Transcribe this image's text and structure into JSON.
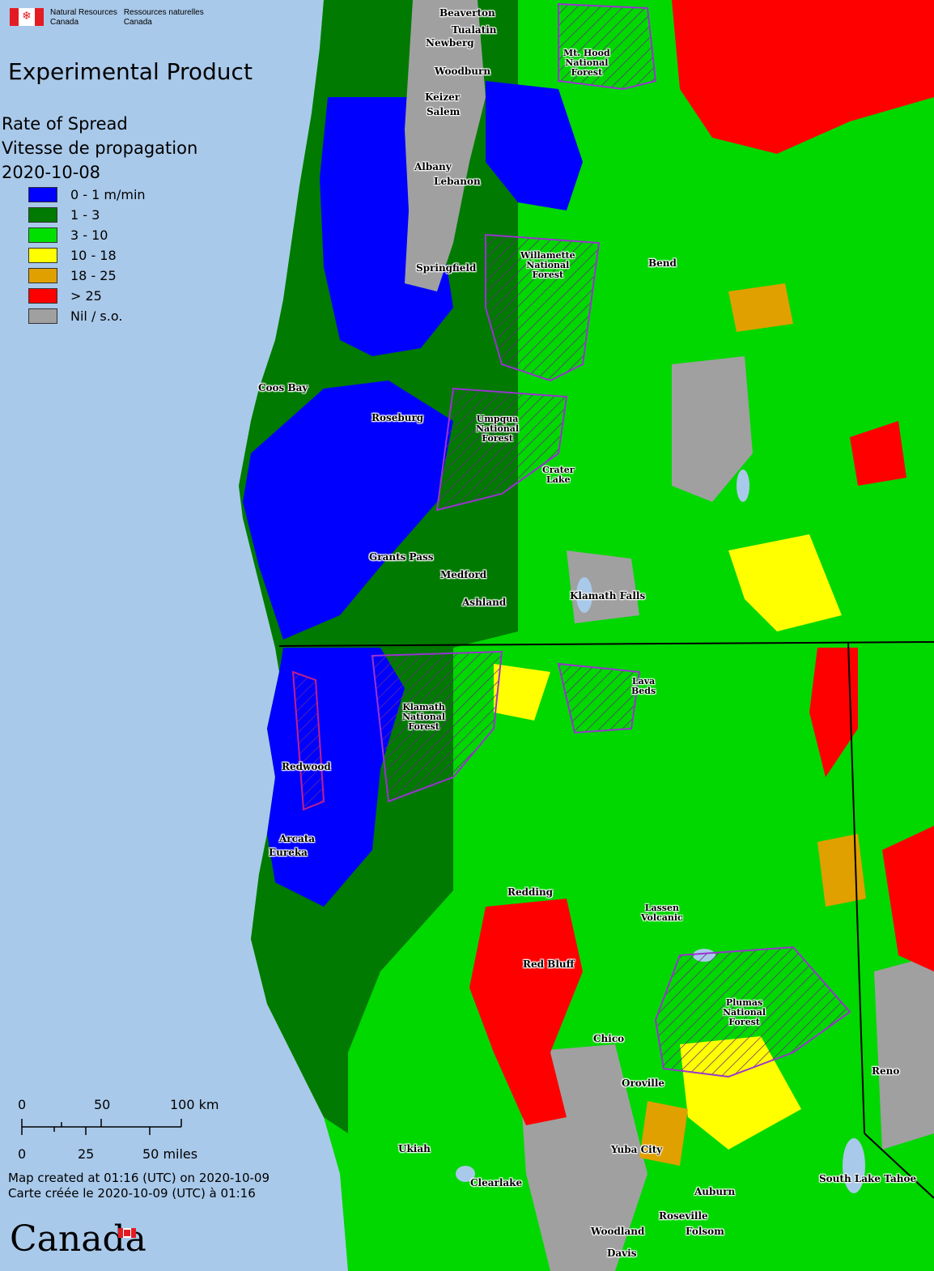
{
  "header": {
    "agency_en": [
      "Natural Resources",
      "Canada"
    ],
    "agency_fr": [
      "Ressources naturelles",
      "Canada"
    ],
    "flag_icon": "canada-flag-icon"
  },
  "product_title": "Experimental Product",
  "legend": {
    "title_en": "Rate of Spread",
    "title_fr": "Vitesse de propagation",
    "date": "2020-10-08",
    "items": [
      {
        "label": "0 - 1 m/min",
        "color": "#0000ff"
      },
      {
        "label": "1 - 3",
        "color": "#007a00"
      },
      {
        "label": "3 - 10",
        "color": "#00e000"
      },
      {
        "label": "10 - 18",
        "color": "#ffff00"
      },
      {
        "label": "18 - 25",
        "color": "#e0a000"
      },
      {
        "label": "> 25",
        "color": "#ff0000"
      },
      {
        "label": "Nil / s.o.",
        "color": "#a0a0a0"
      }
    ]
  },
  "scale": {
    "km_labels": [
      "0",
      "50",
      "100 km"
    ],
    "mile_labels": [
      "0",
      "25",
      "50 miles"
    ]
  },
  "credits": {
    "line_en": "Map created at 01:16 (UTC) on 2020-10-09",
    "line_fr": "Carte créée le 2020-10-09 (UTC) à 01:16"
  },
  "wordmark": "Canada",
  "places": [
    {
      "id": "beaverton",
      "name": "Beaverton"
    },
    {
      "id": "tualatin",
      "name": "Tualatin"
    },
    {
      "id": "newberg",
      "name": "Newberg"
    },
    {
      "id": "woodburn",
      "name": "Woodburn"
    },
    {
      "id": "keizer",
      "name": "Keizer"
    },
    {
      "id": "salem",
      "name": "Salem"
    },
    {
      "id": "albany",
      "name": "Albany"
    },
    {
      "id": "lebanon",
      "name": "Lebanon"
    },
    {
      "id": "springfield",
      "name": "Springfield"
    },
    {
      "id": "bend",
      "name": "Bend"
    },
    {
      "id": "coos-bay",
      "name": "Coos Bay"
    },
    {
      "id": "roseburg",
      "name": "Roseburg"
    },
    {
      "id": "grants-pass",
      "name": "Grants Pass"
    },
    {
      "id": "medford",
      "name": "Medford"
    },
    {
      "id": "ashland",
      "name": "Ashland"
    },
    {
      "id": "klamath-falls",
      "name": "Klamath Falls"
    },
    {
      "id": "redwood",
      "name": "Redwood"
    },
    {
      "id": "arcata",
      "name": "Arcata"
    },
    {
      "id": "eureka",
      "name": "Eureka"
    },
    {
      "id": "redding",
      "name": "Redding"
    },
    {
      "id": "red-bluff",
      "name": "Red Bluff"
    },
    {
      "id": "chico",
      "name": "Chico"
    },
    {
      "id": "oroville",
      "name": "Oroville"
    },
    {
      "id": "yuba-city",
      "name": "Yuba City"
    },
    {
      "id": "ukiah",
      "name": "Ukiah"
    },
    {
      "id": "clearlake",
      "name": "Clearlake"
    },
    {
      "id": "auburn",
      "name": "Auburn"
    },
    {
      "id": "roseville",
      "name": "Roseville"
    },
    {
      "id": "folsom",
      "name": "Folsom"
    },
    {
      "id": "woodland",
      "name": "Woodland"
    },
    {
      "id": "davis",
      "name": "Davis"
    },
    {
      "id": "reno",
      "name": "Reno"
    },
    {
      "id": "south-lake-tahoe",
      "name": "South Lake Tahoe"
    }
  ],
  "parks": [
    {
      "id": "mt-hood",
      "lines": [
        "Mt. Hood",
        "National",
        "Forest"
      ]
    },
    {
      "id": "willamette",
      "lines": [
        "Willamette",
        "National",
        "Forest"
      ]
    },
    {
      "id": "umpqua",
      "lines": [
        "Umpqua",
        "National",
        "Forest"
      ]
    },
    {
      "id": "crater-lake",
      "lines": [
        "Crater",
        "Lake"
      ]
    },
    {
      "id": "klamath",
      "lines": [
        "Klamath",
        "National",
        "Forest"
      ]
    },
    {
      "id": "lava-beds",
      "lines": [
        "Lava",
        "Beds"
      ]
    },
    {
      "id": "lassen",
      "lines": [
        "Lassen",
        "Volcanic"
      ]
    },
    {
      "id": "plumas",
      "lines": [
        "Plumas",
        "National",
        "Forest"
      ]
    }
  ]
}
